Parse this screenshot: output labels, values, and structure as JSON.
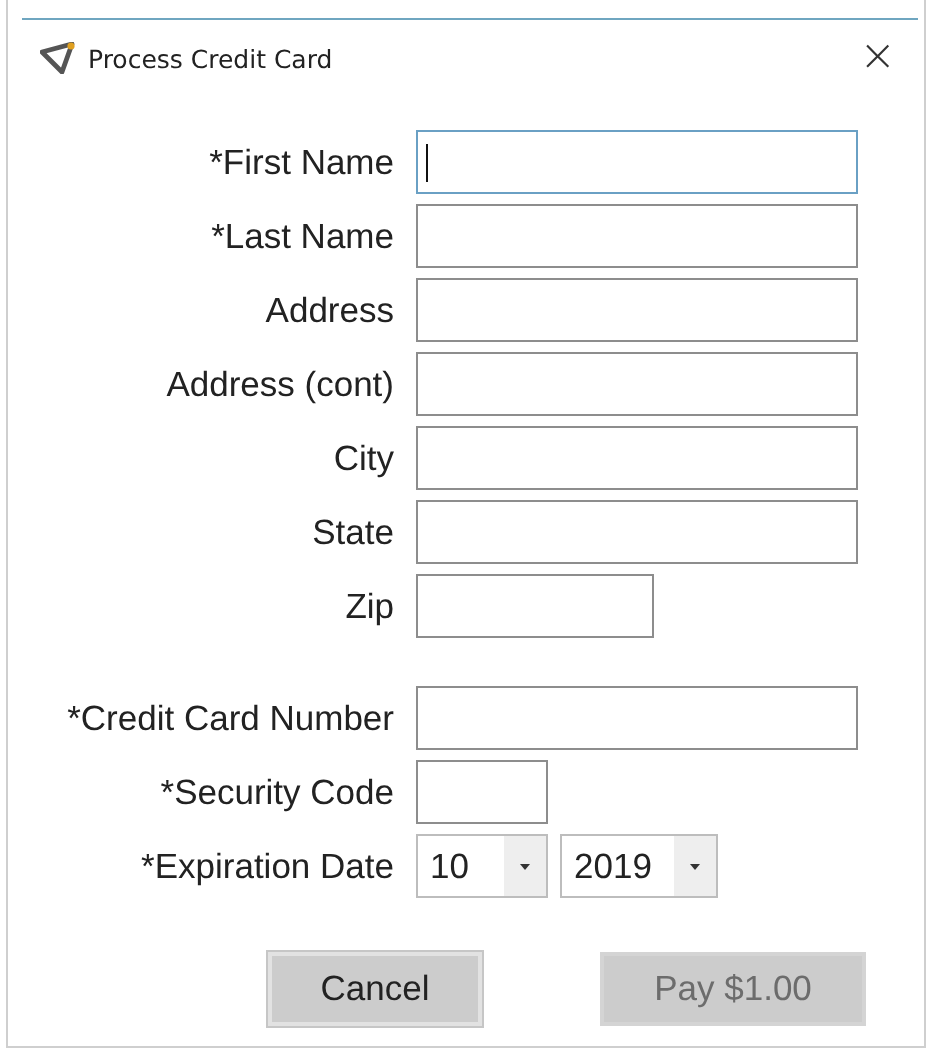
{
  "window": {
    "title": "Process Credit Card",
    "close": "×"
  },
  "address_fields": [
    {
      "label": "*First Name",
      "kind": "text",
      "focused": true
    },
    {
      "label": "*Last Name",
      "kind": "text",
      "focused": false
    },
    {
      "label": "Address",
      "kind": "text",
      "focused": false
    },
    {
      "label": "Address (cont)",
      "kind": "text",
      "focused": false
    },
    {
      "label": "City",
      "kind": "text",
      "focused": false
    },
    {
      "label": "State",
      "kind": "text",
      "focused": false
    },
    {
      "label": "Zip",
      "kind": "zip",
      "focused": false
    }
  ],
  "payment_fields": [
    {
      "label": "*Credit Card Number",
      "kind": "text",
      "focused": false
    },
    {
      "label": "*Security Code",
      "kind": "code",
      "focused": false
    },
    {
      "label": "*Expiration Date",
      "kind": "selects",
      "selects": [
        {
          "value": "10"
        },
        {
          "value": "2019"
        }
      ]
    }
  ],
  "buttons": [
    {
      "label": "Cancel",
      "disabled": false
    },
    {
      "label": "Pay $1.00",
      "disabled": true
    }
  ]
}
